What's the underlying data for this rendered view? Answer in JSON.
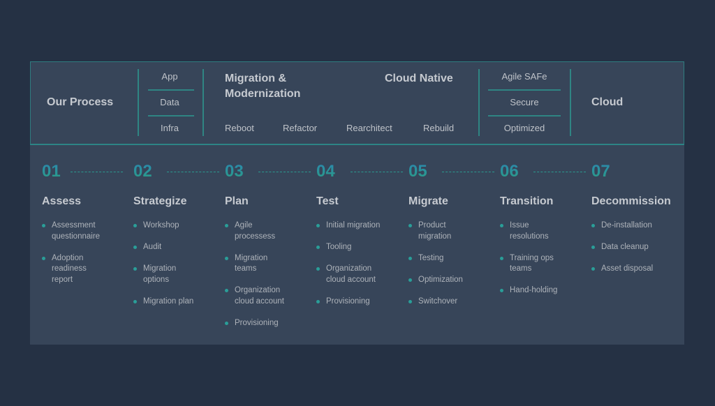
{
  "header": {
    "title": "Our Process",
    "layers": [
      "App",
      "Data",
      "Infra"
    ],
    "migration_title_line1": "Migration &",
    "migration_title_line2": "Modernization",
    "cloud_native": "Cloud Native",
    "strategies": [
      "Reboot",
      "Refactor",
      "Rearchitect",
      "Rebuild"
    ],
    "qualities": [
      "Agile SAFe",
      "Secure",
      "Optimized"
    ],
    "destination": "Cloud"
  },
  "colors": {
    "background": "#253144",
    "card": "#374559",
    "accent_teal": "#2a9e98",
    "number_gradient_top": "#2b86b4",
    "number_gradient_bottom": "#2aa07e"
  },
  "stages": [
    {
      "num": "01",
      "title": "Assess",
      "items": [
        "Assessment questionnaire",
        "Adoption readiness report"
      ]
    },
    {
      "num": "02",
      "title": "Strategize",
      "items": [
        "Workshop",
        "Audit",
        "Migration options",
        "Migration plan"
      ]
    },
    {
      "num": "03",
      "title": "Plan",
      "items": [
        "Agile processess",
        "Migration teams",
        "Organization cloud account",
        "Provisioning"
      ]
    },
    {
      "num": "04",
      "title": "Test",
      "items": [
        "Initial migration",
        "Tooling",
        "Organization cloud account",
        "Provisioning"
      ]
    },
    {
      "num": "05",
      "title": "Migrate",
      "items": [
        "Product migration",
        "Testing",
        "Optimization",
        "Switchover"
      ]
    },
    {
      "num": "06",
      "title": "Transition",
      "items": [
        "Issue resolutions",
        "Training ops teams",
        "Hand-holding"
      ]
    },
    {
      "num": "07",
      "title": "Decommission",
      "items": [
        "De-installation",
        "Data cleanup",
        "Asset disposal"
      ]
    }
  ]
}
